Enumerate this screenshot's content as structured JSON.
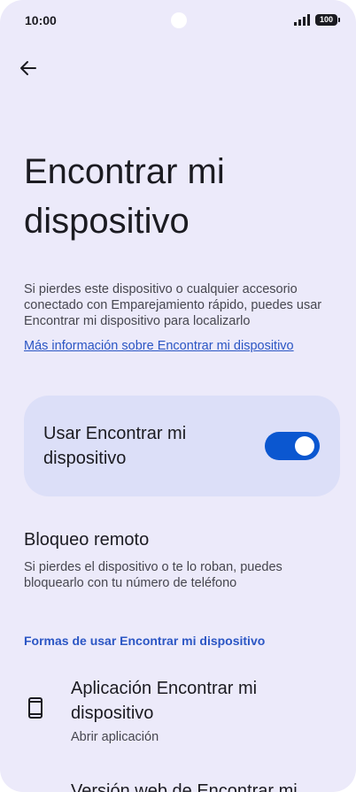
{
  "status_bar": {
    "time": "10:00",
    "battery": "100",
    "signal_icon": "signal-icon",
    "battery_icon": "battery-icon"
  },
  "nav": {
    "back_icon": "arrow-back-icon"
  },
  "page": {
    "title": "Encontrar mi dispositivo",
    "intro": "Si pierdes este dispositivo o cualquier accesorio conectado con Emparejamiento rápido, puedes usar Encontrar mi dispositivo para localizarlo",
    "more_link": "Más información sobre Encontrar mi dispositivo"
  },
  "toggle": {
    "label": "Usar Encontrar mi dispositivo",
    "checked": true,
    "color": "#0b57d0"
  },
  "remote_lock": {
    "title": "Bloqueo remoto",
    "description": "Si pierdes el dispositivo o te lo roban, puedes bloquearlo con tu número de teléfono"
  },
  "ways_section": {
    "header": "Formas de usar Encontrar mi dispositivo",
    "items": [
      {
        "title": "Aplicación Encontrar mi dispositivo",
        "subtitle": "Abrir aplicación",
        "icon": "phone-icon"
      },
      {
        "title": "Versión web de Encontrar mi",
        "subtitle": "",
        "icon": ""
      }
    ]
  }
}
